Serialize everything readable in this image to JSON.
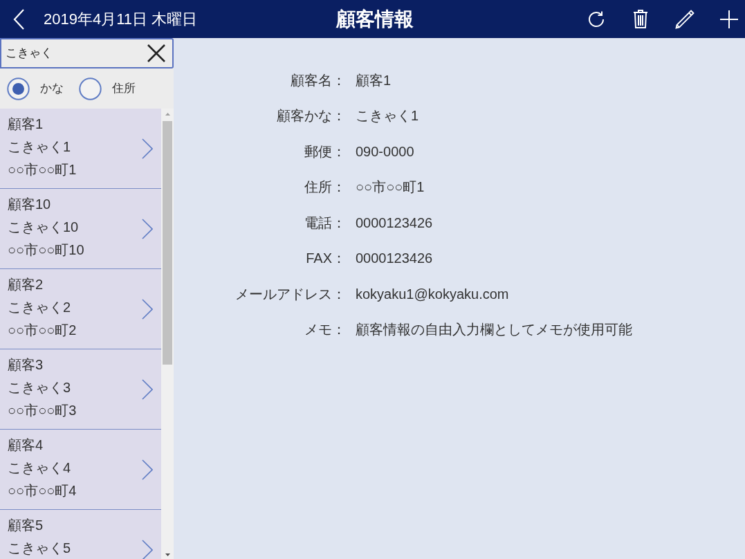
{
  "header": {
    "date": "2019年4月11日 木曜日",
    "title": "顧客情報"
  },
  "search": {
    "value": "こきゃく"
  },
  "search_modes": [
    {
      "label": "かな",
      "selected": true
    },
    {
      "label": "住所",
      "selected": false
    }
  ],
  "customers": [
    {
      "name": "顧客1",
      "kana": "こきゃく1",
      "address": "○○市○○町1"
    },
    {
      "name": "顧客10",
      "kana": "こきゃく10",
      "address": "○○市○○町10"
    },
    {
      "name": "顧客2",
      "kana": "こきゃく2",
      "address": "○○市○○町2"
    },
    {
      "name": "顧客3",
      "kana": "こきゃく3",
      "address": "○○市○○町3"
    },
    {
      "name": "顧客4",
      "kana": "こきゃく4",
      "address": "○○市○○町4"
    },
    {
      "name": "顧客5",
      "kana": "こきゃく5"
    }
  ],
  "details": [
    {
      "label": "顧客名：",
      "value": "顧客1"
    },
    {
      "label": "顧客かな：",
      "value": "こきゃく1"
    },
    {
      "label": "郵便：",
      "value": "090-0000"
    },
    {
      "label": "住所：",
      "value": "○○市○○町1"
    },
    {
      "label": "電話：",
      "value": "0000123426"
    },
    {
      "label": "FAX：",
      "value": "0000123426"
    },
    {
      "label": "メールアドレス：",
      "value": "kokyaku1@kokyaku.com"
    },
    {
      "label": "メモ：",
      "value": "顧客情報の自由入力欄としてメモが使用可能"
    }
  ]
}
